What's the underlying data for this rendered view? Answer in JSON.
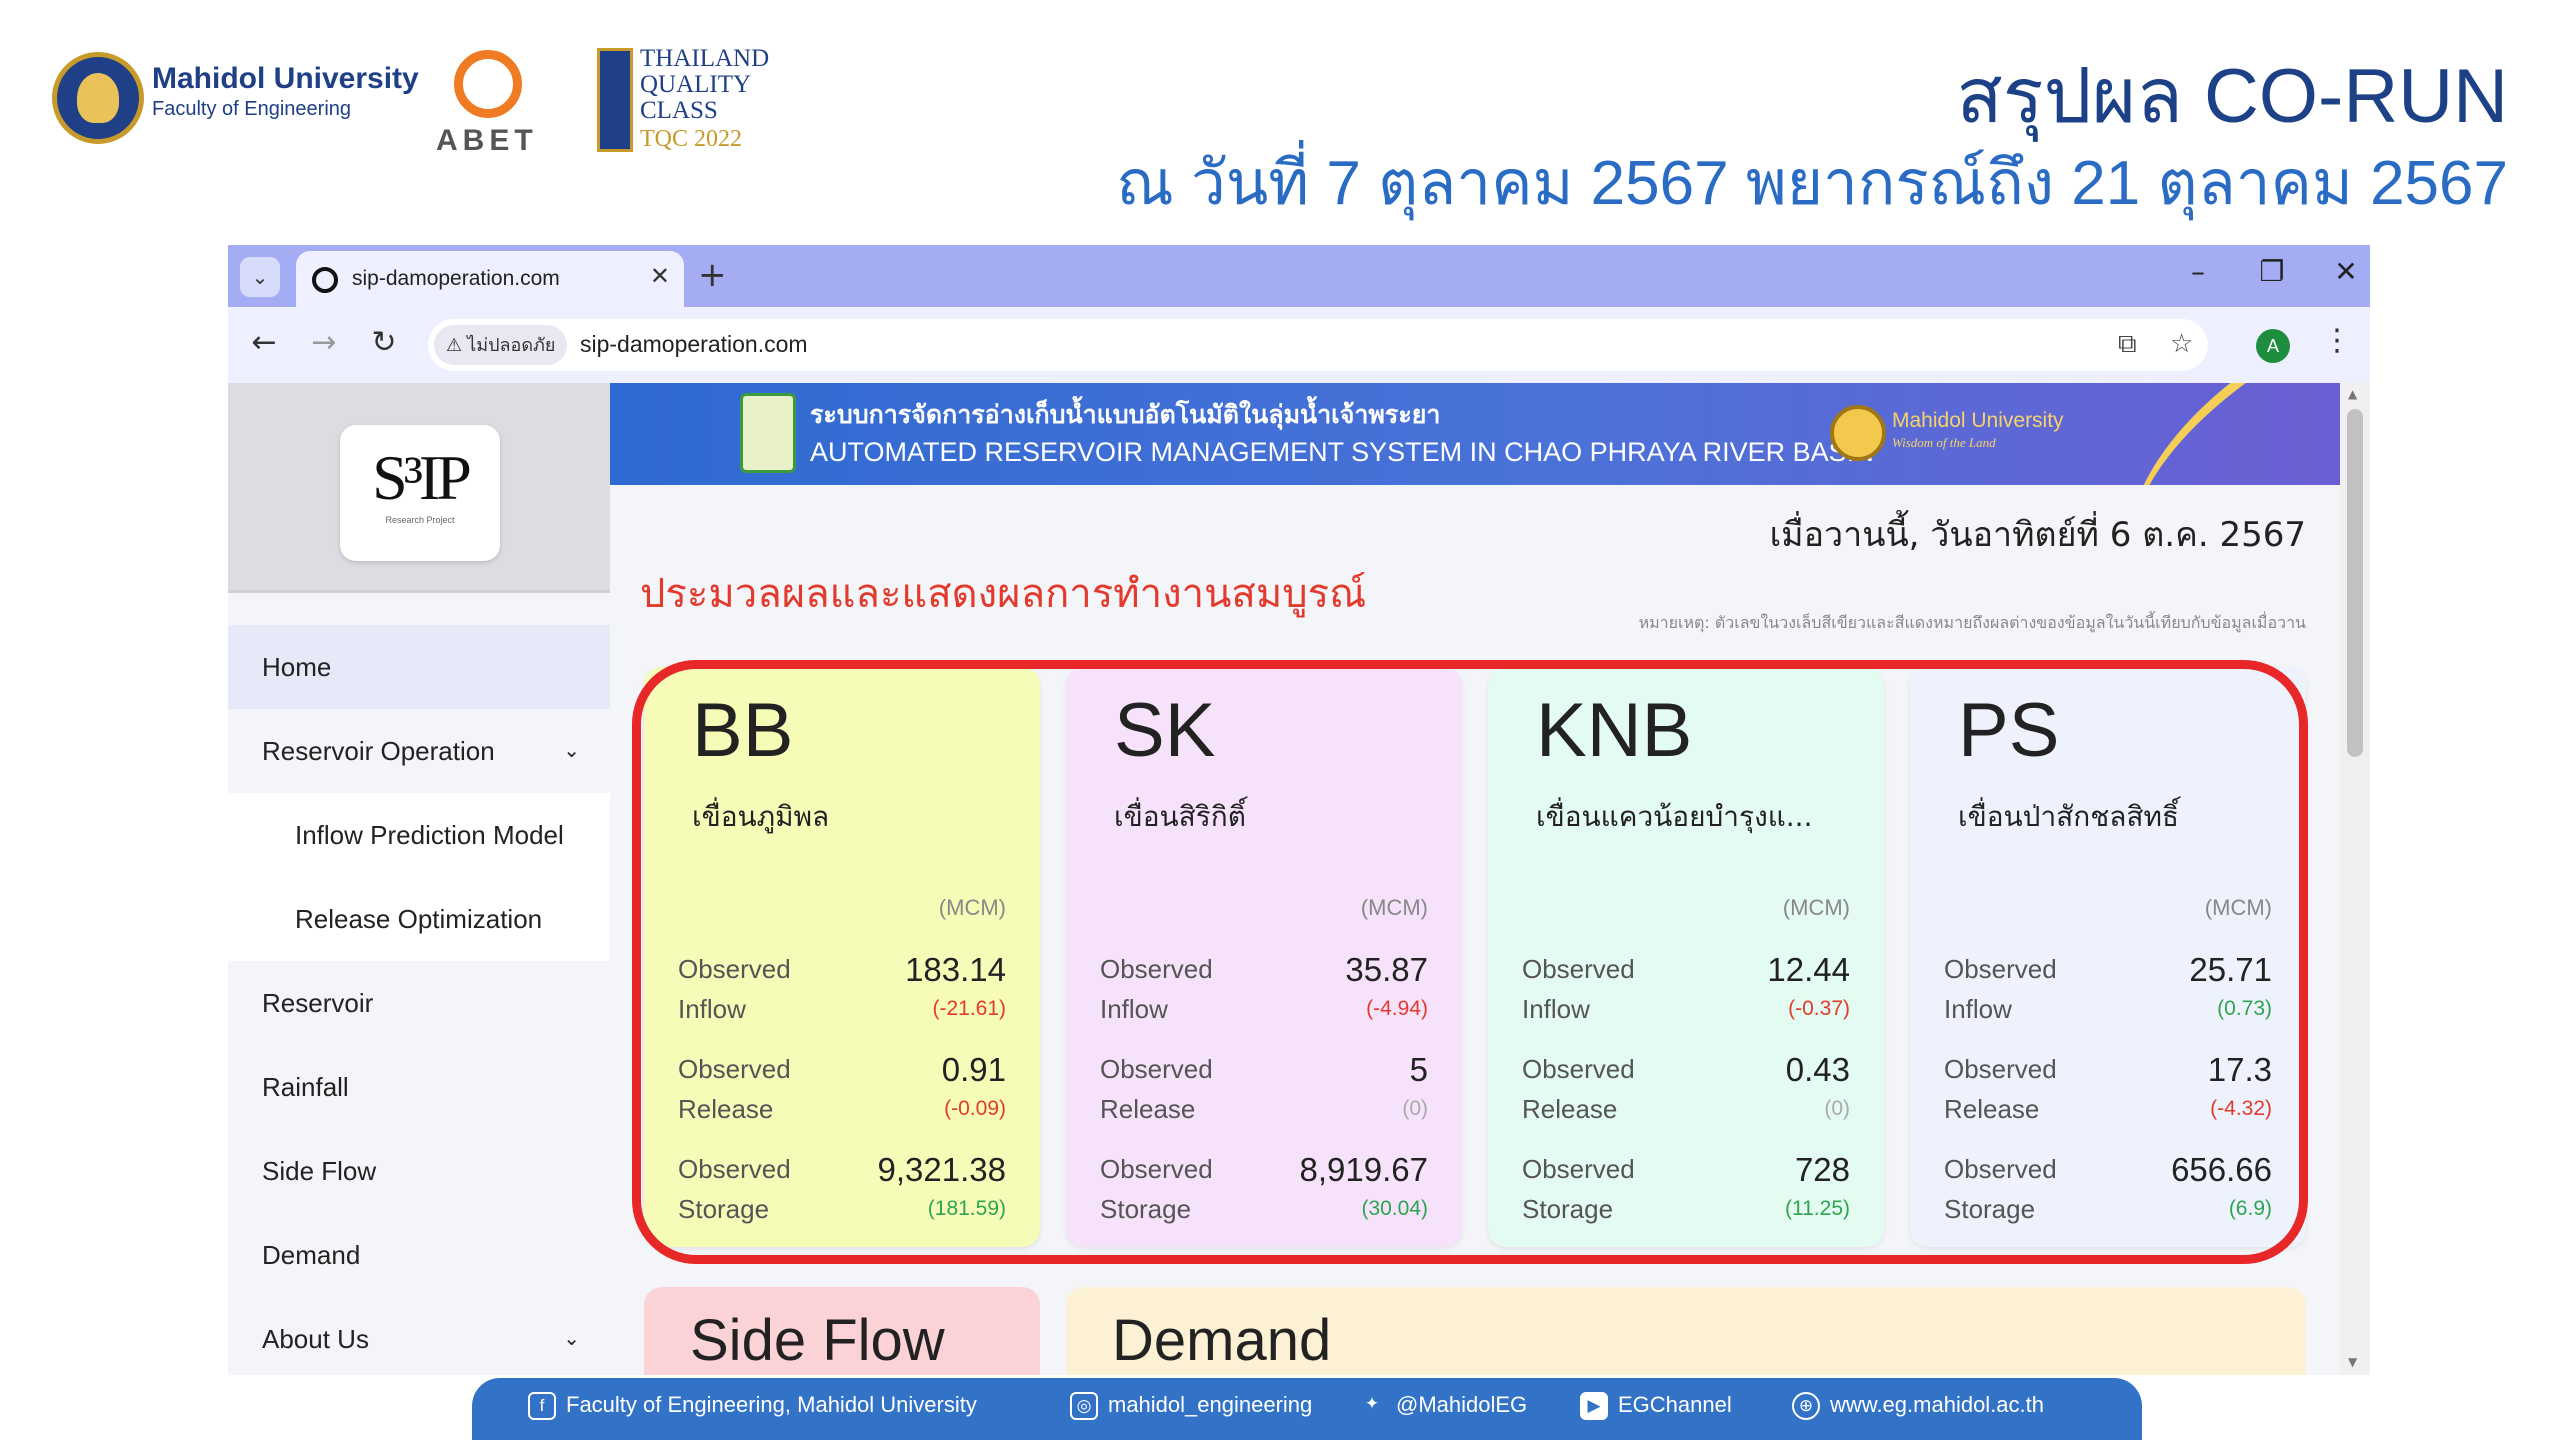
{
  "slide": {
    "logos": {
      "mu_name": "Mahidol University",
      "mu_faculty": "Faculty of Engineering",
      "abet": "ABET",
      "tqc_line1": "THAILAND",
      "tqc_line2": "QUALITY",
      "tqc_line3": "CLASS",
      "tqc_year": "TQC 2022"
    },
    "title": "สรุปผล CO-RUN",
    "subtitle": "ณ วันที่ 7 ตุลาคม 2567 พยากรณ์ถึง 21 ตุลาคม 2567"
  },
  "browser": {
    "tab_title": "sip-damoperation.com",
    "security_label": "ไม่ปลอดภัย",
    "url": "sip-damoperation.com",
    "profile_initial": "A"
  },
  "sidebar": {
    "logo_text": "S³IP",
    "logo_sub": "Research Project",
    "items": [
      {
        "label": "Home"
      },
      {
        "label": "Reservoir Operation"
      },
      {
        "label": "Inflow Prediction Model"
      },
      {
        "label": "Release Optimization"
      },
      {
        "label": "Reservoir"
      },
      {
        "label": "Rainfall"
      },
      {
        "label": "Side Flow"
      },
      {
        "label": "Demand"
      },
      {
        "label": "About Us"
      }
    ]
  },
  "banner": {
    "thai": "ระบบการจัดการอ่างเก็บน้ำแบบอัตโนมัติในลุ่มน้ำเจ้าพระยา",
    "english": "AUTOMATED RESERVOIR MANAGEMENT SYSTEM IN CHAO PHRAYA RIVER BASIN",
    "mu": "Mahidol University",
    "mu_tagline": "Wisdom of the Land"
  },
  "main": {
    "date": "เมื่อวานนี้, วันอาทิตย์ที่ 6 ต.ค. 2567",
    "headline": "ประมวลผลและแสดงผลการทำงานสมบูรณ์",
    "note": "หมายเหตุ: ตัวเลขในวงเล็บสีเขียวและสีแดงหมายถึงผลต่างของข้อมูลในวันนี้เทียบกับข้อมูลเมื่อวาน"
  },
  "cards": [
    {
      "code": "BB",
      "name": "เขื่อนภูมิพล",
      "unit": "(MCM)",
      "bg": "#f7fbb8",
      "inflow_label_1": "Observed",
      "inflow_label_2": "Inflow",
      "inflow": "183.14",
      "inflow_diff": "(-21.61)",
      "release_label_1": "Observed",
      "release_label_2": "Release",
      "release": "0.91",
      "release_diff": "(-0.09)",
      "storage_label_1": "Observed",
      "storage_label_2": "Storage",
      "storage": "9,321.38",
      "storage_diff": "(181.59)"
    },
    {
      "code": "SK",
      "name": "เขื่อนสิริกิติ์",
      "unit": "(MCM)",
      "bg": "#f7e2fb",
      "inflow_label_1": "Observed",
      "inflow_label_2": "Inflow",
      "inflow": "35.87",
      "inflow_diff": "(-4.94)",
      "release_label_1": "Observed",
      "release_label_2": "Release",
      "release": "5",
      "release_diff": "(0)",
      "storage_label_1": "Observed",
      "storage_label_2": "Storage",
      "storage": "8,919.67",
      "storage_diff": "(30.04)"
    },
    {
      "code": "KNB",
      "name": "เขื่อนแควน้อยบำรุงแ...",
      "unit": "(MCM)",
      "bg": "#e3fbf0",
      "inflow_label_1": "Observed",
      "inflow_label_2": "Inflow",
      "inflow": "12.44",
      "inflow_diff": "(-0.37)",
      "release_label_1": "Observed",
      "release_label_2": "Release",
      "release": "0.43",
      "release_diff": "(0)",
      "storage_label_1": "Observed",
      "storage_label_2": "Storage",
      "storage": "728",
      "storage_diff": "(11.25)"
    },
    {
      "code": "PS",
      "name": "เขื่อนป่าสักชลสิทธิ์",
      "unit": "(MCM)",
      "bg": "#eef2fc",
      "inflow_label_1": "Observed",
      "inflow_label_2": "Inflow",
      "inflow": "25.71",
      "inflow_diff": "(0.73)",
      "release_label_1": "Observed",
      "release_label_2": "Release",
      "release": "17.3",
      "release_diff": "(-4.32)",
      "storage_label_1": "Observed",
      "storage_label_2": "Storage",
      "storage": "656.66",
      "storage_diff": "(6.9)"
    }
  ],
  "lower_cards": [
    {
      "title": "Side Flow",
      "bg": "#fbd3d6"
    },
    {
      "title": "Demand",
      "bg": "#fcf1d4"
    }
  ],
  "footer": {
    "facebook": "Faculty of Engineering, Mahidol University",
    "instagram": "mahidol_engineering",
    "twitter": "@MahidolEG",
    "youtube": "EGChannel",
    "website": "www.eg.mahidol.ac.th"
  },
  "colors": {
    "highlight": "#e82828",
    "title": "#1c4187",
    "subtitle": "#2a6bc4",
    "negative": "#e23a2c",
    "positive": "#2ea44f",
    "footer": "#3272c7"
  }
}
